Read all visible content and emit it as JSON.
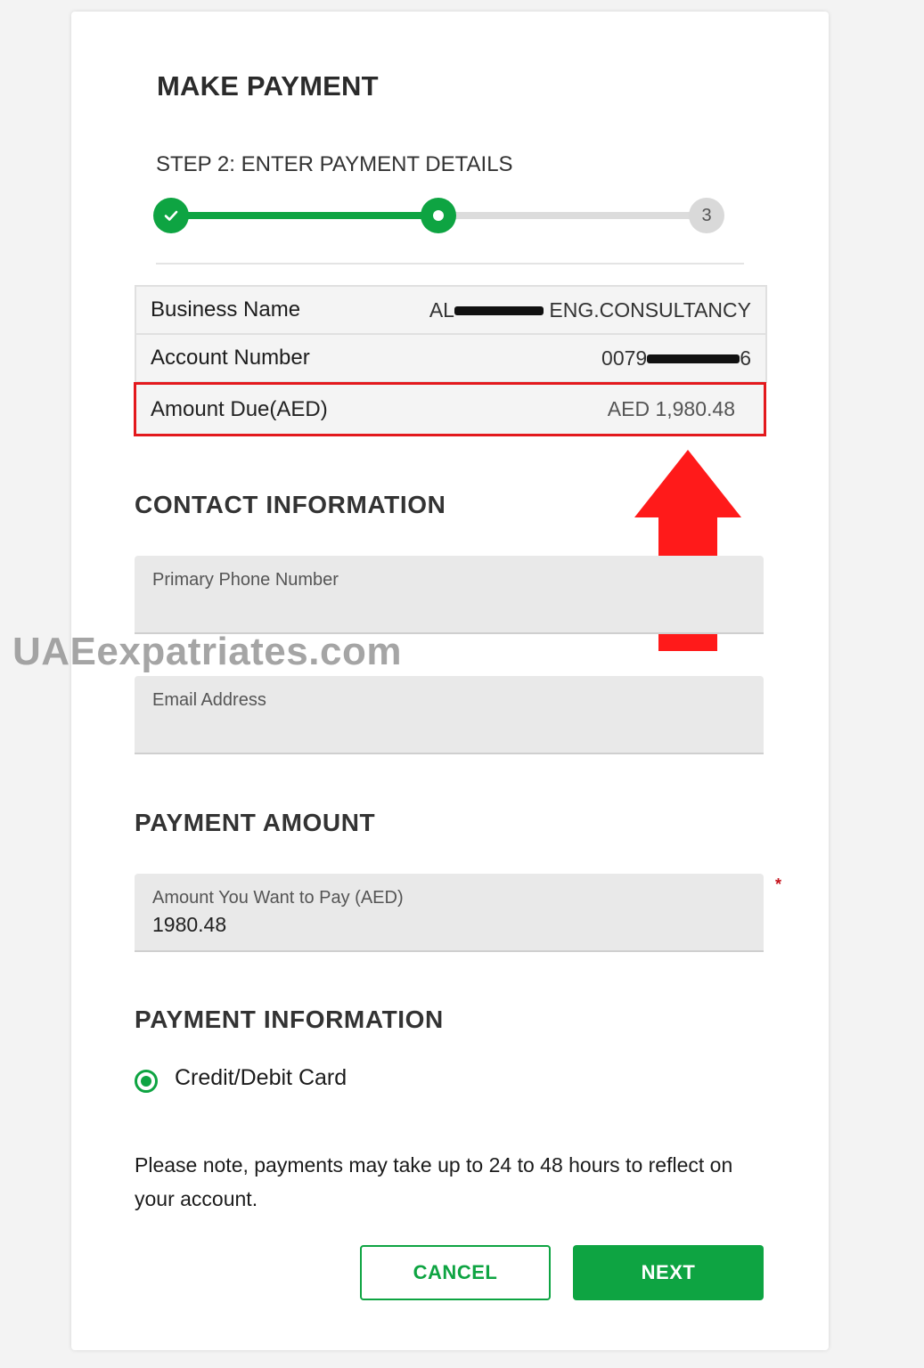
{
  "page": {
    "title": "MAKE PAYMENT",
    "step_title": "STEP 2: ENTER PAYMENT DETAILS"
  },
  "stepper": {
    "current_step": 2,
    "total_steps": 3,
    "step3_label": "3",
    "completed_icon": "check-icon"
  },
  "summary": {
    "business_name_label": "Business Name",
    "business_name_prefix": "AL",
    "business_name_suffix": "ENG.CONSULTANCY",
    "account_number_label": "Account Number",
    "account_number_prefix": "0079",
    "account_number_suffix": "6",
    "amount_due_label": "Amount Due(AED)",
    "amount_due_value": "AED 1,980.48"
  },
  "contact": {
    "heading": "CONTACT INFORMATION",
    "phone_label": "Primary Phone Number",
    "phone_value": "",
    "email_label": "Email Address",
    "email_value": ""
  },
  "payment_amount": {
    "heading": "PAYMENT AMOUNT",
    "field_label": "Amount You Want to Pay (AED)",
    "field_value": "1980.48",
    "required_marker": "*"
  },
  "payment_info": {
    "heading": "PAYMENT INFORMATION",
    "option_label": "Credit/Debit Card",
    "option_selected": true
  },
  "note": "Please note, payments may take up to 24 to 48 hours to reflect on your account.",
  "buttons": {
    "cancel": "CANCEL",
    "next": "NEXT"
  },
  "watermark": "UAEexpatriates.com",
  "colors": {
    "accent": "#0ea442",
    "highlight": "#e3191d",
    "arrow": "#ff1a1a"
  }
}
